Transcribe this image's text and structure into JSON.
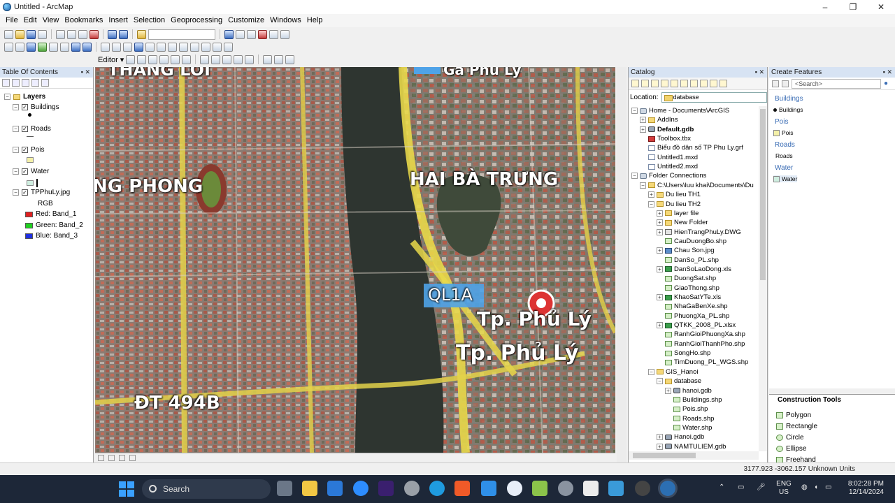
{
  "window": {
    "title": "Untitled - ArcMap",
    "controls": [
      "–",
      "❐",
      "✕"
    ]
  },
  "menu": [
    "File",
    "Edit",
    "View",
    "Bookmarks",
    "Insert",
    "Selection",
    "Geoprocessing",
    "Customize",
    "Windows",
    "Help"
  ],
  "editor_toolbar": {
    "label": "Editor ▾"
  },
  "toc": {
    "title": "Table Of Contents",
    "root": "Layers",
    "layers": [
      {
        "name": "Buildings",
        "checked": true
      },
      {
        "name": "Roads",
        "checked": true
      },
      {
        "name": "Pois",
        "checked": true
      },
      {
        "name": "Water",
        "checked": true
      },
      {
        "name": "TPPhuLy.jpg",
        "checked": true
      }
    ],
    "raster_legend": {
      "type_label": "RGB",
      "bands": [
        {
          "label": "Red:   Band_1",
          "color": "#e02020"
        },
        {
          "label": "Green: Band_2",
          "color": "#20d020"
        },
        {
          "label": "Blue:  Band_3",
          "color": "#2030e0"
        }
      ]
    }
  },
  "map": {
    "labels": [
      "THANG LOI",
      "Ga Phu Ly",
      "NG PHONG",
      "HAI BÀ TRƯNG",
      "QL1A",
      "Tp. Phủ Lý",
      "Tp. Phủ Lý",
      "ĐT 494B"
    ]
  },
  "catalog": {
    "title": "Catalog",
    "location_label": "Location:",
    "location_value": "database",
    "tree": [
      {
        "label": "Home - Documents\\ArcGIS",
        "icon": "db",
        "exp": "−"
      },
      {
        "label": "AddIns",
        "icon": "folder",
        "exp": "+"
      },
      {
        "label": "Default.gdb",
        "icon": "gdb",
        "exp": "+",
        "bold": true
      },
      {
        "label": "Toolbox.tbx",
        "icon": "tbx",
        "exp": ""
      },
      {
        "label": "Biểu đồ dân số TP Phu Ly.grf",
        "icon": "doc",
        "exp": ""
      },
      {
        "label": "Untitled1.mxd",
        "icon": "doc",
        "exp": ""
      },
      {
        "label": "Untitled2.mxd",
        "icon": "doc",
        "exp": ""
      },
      {
        "label": "Folder Connections",
        "icon": "db",
        "exp": "−"
      },
      {
        "label": "C:\\Users\\luu khai\\Documents\\Du",
        "icon": "folder",
        "exp": "−"
      },
      {
        "label": "Du lieu TH1",
        "icon": "folder",
        "exp": "+"
      },
      {
        "label": "Du lieu TH2",
        "icon": "folder",
        "exp": "−"
      },
      {
        "label": "layer file",
        "icon": "folder",
        "exp": "+"
      },
      {
        "label": "New Folder",
        "icon": "folder",
        "exp": "+"
      },
      {
        "label": "HienTrangPhuLy.DWG",
        "icon": "dwg",
        "exp": "+"
      },
      {
        "label": "CauDuongBo.shp",
        "icon": "shp",
        "exp": ""
      },
      {
        "label": "Chau Son.jpg",
        "icon": "img",
        "exp": "+"
      },
      {
        "label": "DanSo_PL.shp",
        "icon": "shp",
        "exp": ""
      },
      {
        "label": "DanSoLaoDong.xls",
        "icon": "xls",
        "exp": "+"
      },
      {
        "label": "DuongSat.shp",
        "icon": "shp",
        "exp": ""
      },
      {
        "label": "GiaoThong.shp",
        "icon": "shp",
        "exp": ""
      },
      {
        "label": "KhaoSatYTe.xls",
        "icon": "xls",
        "exp": "+"
      },
      {
        "label": "NhaGaBenXe.shp",
        "icon": "shp",
        "exp": ""
      },
      {
        "label": "PhuongXa_PL.shp",
        "icon": "shp",
        "exp": ""
      },
      {
        "label": "QTKK_2008_PL.xlsx",
        "icon": "xls",
        "exp": "+"
      },
      {
        "label": "RanhGioiPhuongXa.shp",
        "icon": "shp",
        "exp": ""
      },
      {
        "label": "RanhGioiThanhPho.shp",
        "icon": "shp",
        "exp": ""
      },
      {
        "label": "SongHo.shp",
        "icon": "shp",
        "exp": ""
      },
      {
        "label": "TimDuong_PL_WGS.shp",
        "icon": "shp",
        "exp": ""
      },
      {
        "label": "GIS_Hanoi",
        "icon": "folder",
        "exp": "−"
      },
      {
        "label": "database",
        "icon": "folder",
        "exp": "−"
      },
      {
        "label": "hanoi.gdb",
        "icon": "gdb",
        "exp": "+"
      },
      {
        "label": "Buildings.shp",
        "icon": "shp",
        "exp": ""
      },
      {
        "label": "Pois.shp",
        "icon": "shp",
        "exp": ""
      },
      {
        "label": "Roads.shp",
        "icon": "shp",
        "exp": ""
      },
      {
        "label": "Water.shp",
        "icon": "shp",
        "exp": ""
      },
      {
        "label": "Hanoi.gdb",
        "icon": "gdb",
        "exp": "+"
      },
      {
        "label": "NAMTULIEM.gdb",
        "icon": "gdb",
        "exp": "+"
      }
    ]
  },
  "create_features": {
    "title": "Create Features",
    "search_placeholder": "<Search>",
    "groups": [
      {
        "header": "Buildings",
        "item": "Buildings",
        "swatch": "#111111",
        "swatch_shape": "dot"
      },
      {
        "header": "Pois",
        "item": "Pois",
        "swatch": "#f4f0a8",
        "swatch_shape": "box"
      },
      {
        "header": "Roads",
        "item": "Roads",
        "swatch": "",
        "swatch_shape": "none"
      },
      {
        "header": "Water",
        "item": "Water",
        "swatch": "#cfeee0",
        "swatch_shape": "box"
      }
    ]
  },
  "construction_tools": {
    "title": "Construction Tools",
    "items": [
      "Polygon",
      "Rectangle",
      "Circle",
      "Ellipse",
      "Freehand"
    ]
  },
  "statusbar": {
    "coords": "3177.923  -3062.157 Unknown Units"
  },
  "taskbar": {
    "search": "Search",
    "lang": "ENG",
    "region": "US",
    "time": "8:02:28 PM",
    "date": "12/14/2024"
  }
}
